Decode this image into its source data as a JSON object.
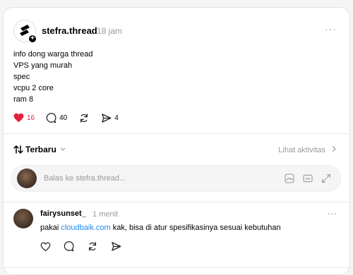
{
  "post": {
    "username": "stefra.thread",
    "time": "18 jam",
    "more_label": "···",
    "lines": [
      "info dong warga thread",
      "VPS yang murah",
      "spec",
      "vcpu 2 core",
      "ram 8"
    ],
    "likes": "16",
    "comments": "40",
    "shares": "4",
    "accent_like_color": "#e5223e"
  },
  "sort": {
    "label": "Terbaru",
    "activity_label": "Lihat aktivitas"
  },
  "reply": {
    "placeholder": "Balas ke stefra.thread..."
  },
  "comment": {
    "username": "fairysunset_",
    "time": "1 menit",
    "more_label": "···",
    "text_before": "pakai ",
    "link": "cloudbaik.com",
    "text_after": " kak, bisa di atur spesifikasinya sesuai kebutuhan",
    "link_color": "#1f8ce8"
  }
}
